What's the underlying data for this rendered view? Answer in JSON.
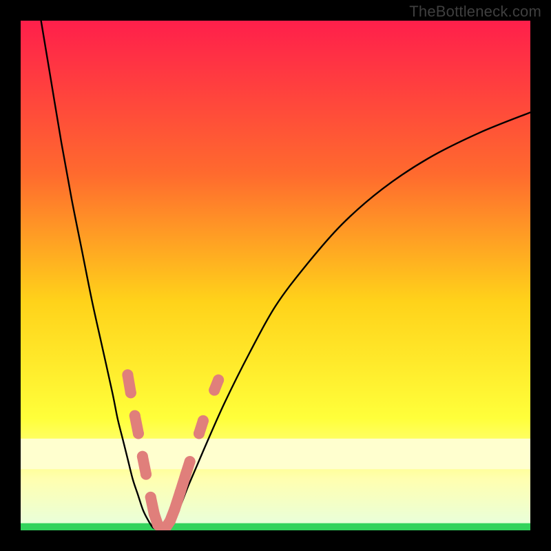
{
  "watermark": "TheBottleneck.com",
  "colors": {
    "frame_bg": "#000000",
    "curve": "#000000",
    "dots_fill": "#e07f7b",
    "dots_stroke": "#c46763",
    "green_band": "#32d35c",
    "gradient_top": "#ff1f4b",
    "gradient_mid1": "#ff6a2e",
    "gradient_mid2": "#ffd21a",
    "gradient_mid3": "#ffff3a",
    "gradient_pale": "#ffffb0",
    "gradient_bottom": "#e6ffe0"
  },
  "chart_data": {
    "type": "line",
    "title": "",
    "xlabel": "",
    "ylabel": "",
    "xlim": [
      0,
      100
    ],
    "ylim": [
      0,
      100
    ],
    "series": [
      {
        "name": "left-arm",
        "x": [
          4,
          6,
          8,
          10,
          12,
          14,
          16,
          18,
          19,
          20,
          21,
          22,
          23,
          24,
          25,
          26
        ],
        "y": [
          100,
          88,
          76,
          65,
          55,
          45,
          36,
          27,
          22,
          18,
          14,
          10,
          7,
          4,
          2,
          0.5
        ]
      },
      {
        "name": "trough",
        "x": [
          26,
          27,
          28,
          29
        ],
        "y": [
          0.5,
          0.3,
          0.3,
          0.6
        ]
      },
      {
        "name": "right-arm",
        "x": [
          29,
          31,
          33,
          36,
          40,
          45,
          50,
          56,
          63,
          71,
          80,
          90,
          100
        ],
        "y": [
          0.6,
          4,
          9,
          16,
          25,
          35,
          44,
          52,
          60,
          67,
          73,
          78,
          82
        ]
      }
    ],
    "scatter": [
      {
        "x": 21.0,
        "y": 30.5
      },
      {
        "x": 21.6,
        "y": 27.0
      },
      {
        "x": 22.4,
        "y": 22.5
      },
      {
        "x": 23.1,
        "y": 19.0
      },
      {
        "x": 23.9,
        "y": 14.5
      },
      {
        "x": 24.6,
        "y": 11.0
      },
      {
        "x": 25.5,
        "y": 6.5
      },
      {
        "x": 26.2,
        "y": 3.2
      },
      {
        "x": 26.9,
        "y": 1.1
      },
      {
        "x": 27.7,
        "y": 0.4
      },
      {
        "x": 28.5,
        "y": 0.6
      },
      {
        "x": 29.3,
        "y": 1.8
      },
      {
        "x": 30.2,
        "y": 4.1
      },
      {
        "x": 31.3,
        "y": 7.5
      },
      {
        "x": 32.4,
        "y": 11.0
      },
      {
        "x": 33.2,
        "y": 13.5
      },
      {
        "x": 35.0,
        "y": 19.0
      },
      {
        "x": 35.8,
        "y": 21.5
      },
      {
        "x": 38.0,
        "y": 27.5
      },
      {
        "x": 38.8,
        "y": 29.5
      }
    ],
    "bands": [
      {
        "name": "pale-yellow",
        "y0": 12.0,
        "y1": 18.0
      },
      {
        "name": "green",
        "y0": 0.0,
        "y1": 1.4
      }
    ]
  }
}
